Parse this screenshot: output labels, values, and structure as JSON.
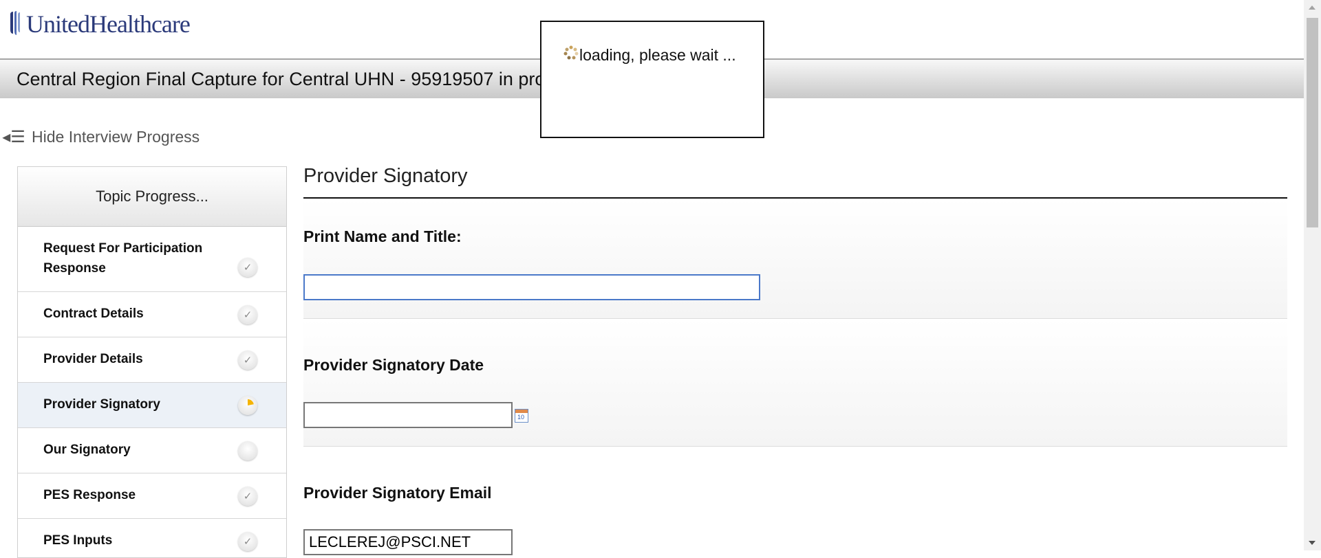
{
  "header": {
    "brand": "UnitedHealthcare",
    "title": "Central Region Final Capture for Central UHN - 95919507 in pro"
  },
  "progress_toggle": {
    "label": "Hide Interview Progress",
    "icon": "collapse-list-icon"
  },
  "sidebar": {
    "heading": "Topic Progress...",
    "items": [
      {
        "label": "Request For Participation Response",
        "status": "complete"
      },
      {
        "label": "Contract Details",
        "status": "complete"
      },
      {
        "label": "Provider Details",
        "status": "complete"
      },
      {
        "label": "Provider Signatory",
        "status": "in-progress"
      },
      {
        "label": "Our Signatory",
        "status": "not-started"
      },
      {
        "label": "PES Response",
        "status": "complete"
      },
      {
        "label": "PES Inputs",
        "status": "complete"
      }
    ]
  },
  "main": {
    "page_title": "Provider Signatory",
    "questions": [
      {
        "label": "Print Name and Title:",
        "value": ""
      },
      {
        "label": "Provider Signatory Date",
        "value": ""
      },
      {
        "label": "Provider Signatory Email",
        "value": "LECLEREJ@PSCI.NET"
      }
    ]
  },
  "loader": {
    "text": "loading, please wait ..."
  },
  "colors": {
    "brand": "#2b3a7a",
    "focus_border": "#4a78c9",
    "active_topic": "#ecf1f7",
    "in_progress": "#f5b400"
  }
}
